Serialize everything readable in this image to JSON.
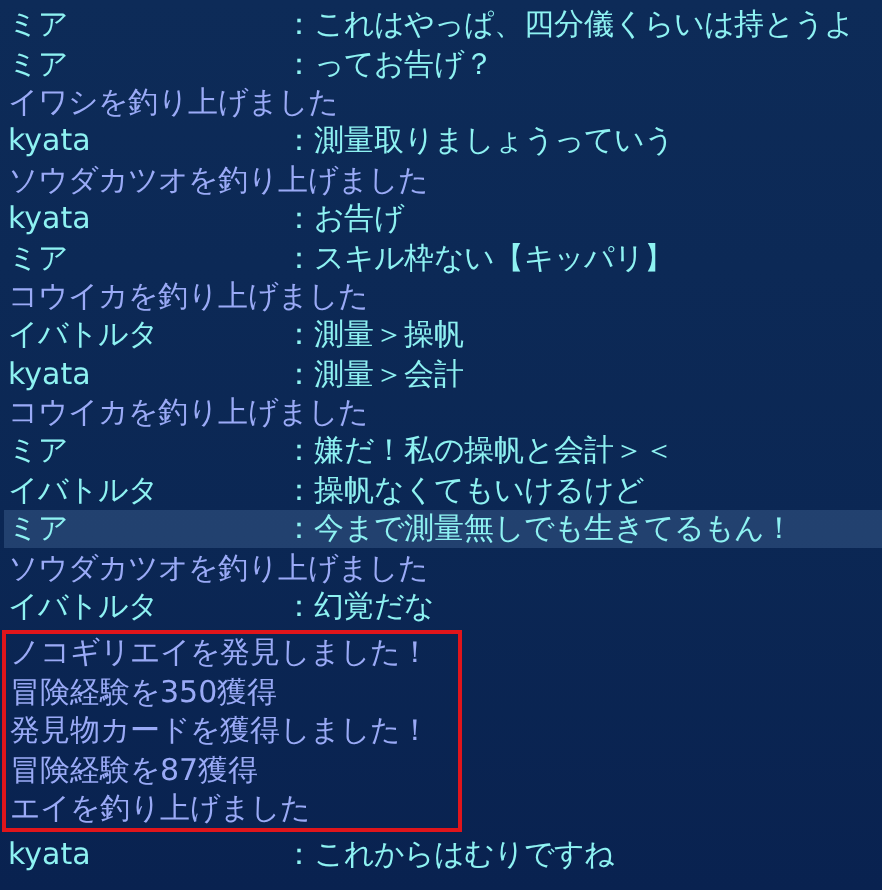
{
  "sections": [
    {
      "boxed": false,
      "lines": [
        {
          "kind": "chat",
          "speaker": "ミア",
          "message": "：これはやっぱ、四分儀くらいは持とうよ",
          "highlighted": false
        },
        {
          "kind": "chat",
          "speaker": "ミア",
          "message": "：ってお告げ？",
          "highlighted": false
        },
        {
          "kind": "system",
          "message": "イワシを釣り上げました",
          "highlighted": false
        },
        {
          "kind": "chat",
          "speaker": "kyata",
          "message": "：測量取りましょうっていう",
          "highlighted": false
        },
        {
          "kind": "system",
          "message": "ソウダカツオを釣り上げました",
          "highlighted": false
        },
        {
          "kind": "chat",
          "speaker": "kyata",
          "message": "：お告げ",
          "highlighted": false
        },
        {
          "kind": "chat",
          "speaker": "ミア",
          "message": "：スキル枠ない【キッパリ】",
          "highlighted": false
        },
        {
          "kind": "system",
          "message": "コウイカを釣り上げました",
          "highlighted": false
        },
        {
          "kind": "chat",
          "speaker": "イバトルタ",
          "message": "：測量＞操帆",
          "highlighted": false
        },
        {
          "kind": "chat",
          "speaker": "kyata",
          "message": "：測量＞会計",
          "highlighted": false
        },
        {
          "kind": "system",
          "message": "コウイカを釣り上げました",
          "highlighted": false
        },
        {
          "kind": "chat",
          "speaker": "ミア",
          "message": "：嫌だ！私の操帆と会計＞＜",
          "highlighted": false
        },
        {
          "kind": "chat",
          "speaker": "イバトルタ",
          "message": "：操帆なくてもいけるけど",
          "highlighted": false
        },
        {
          "kind": "chat",
          "speaker": "ミア",
          "message": "：今まで測量無しでも生きてるもん！",
          "highlighted": true
        },
        {
          "kind": "system",
          "message": "ソウダカツオを釣り上げました",
          "highlighted": false
        },
        {
          "kind": "chat",
          "speaker": "イバトルタ",
          "message": "：幻覚だな",
          "highlighted": false
        }
      ]
    },
    {
      "boxed": true,
      "lines": [
        {
          "kind": "system",
          "message": "ノコギリエイを発見しました！",
          "highlighted": false
        },
        {
          "kind": "system",
          "message": "冒険経験を350獲得",
          "highlighted": false
        },
        {
          "kind": "system",
          "message": "発見物カードを獲得しました！",
          "highlighted": false
        },
        {
          "kind": "system",
          "message": "冒険経験を87獲得",
          "highlighted": false
        },
        {
          "kind": "system",
          "message": "エイを釣り上げました",
          "highlighted": false
        }
      ]
    },
    {
      "boxed": false,
      "lines": [
        {
          "kind": "chat",
          "speaker": "kyata",
          "message": "：これからはむりですね",
          "highlighted": false
        }
      ]
    }
  ]
}
